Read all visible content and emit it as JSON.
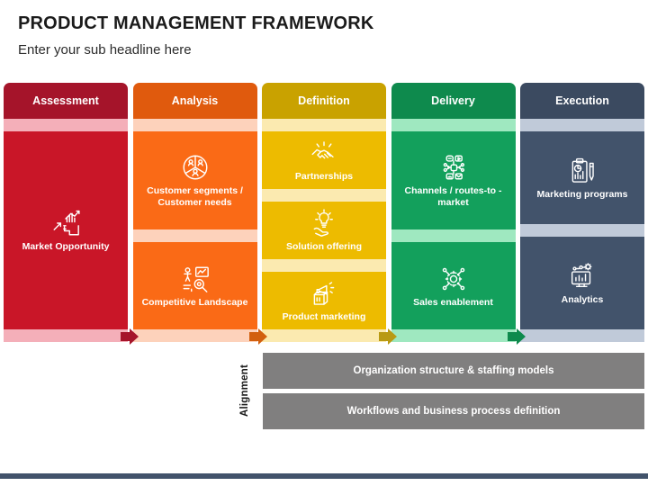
{
  "header": {
    "title": "PRODUCT MANAGEMENT FRAMEWORK",
    "subtitle": "Enter your sub headline here"
  },
  "columns": [
    {
      "name": "assessment",
      "header": "Assessment",
      "header_color": "#a5142a",
      "main_color": "#c91628",
      "tint_color": "#f4afb9",
      "cards": [
        {
          "label": "Market Opportunity",
          "icon": "growth-chart-stairs-icon"
        }
      ]
    },
    {
      "name": "analysis",
      "header": "Analysis",
      "header_color": "#e05a0d",
      "main_color": "#fa6a16",
      "tint_color": "#fdd2bb",
      "cards": [
        {
          "label": "Customer segments / Customer needs",
          "icon": "customer-segments-icon"
        },
        {
          "label": "Competitive Landscape",
          "icon": "competitive-landscape-icon"
        }
      ]
    },
    {
      "name": "definition",
      "header": "Definition",
      "header_color": "#c9a200",
      "main_color": "#edbb00",
      "tint_color": "#fbeab0",
      "cards": [
        {
          "label": "Partnerships",
          "icon": "handshake-icon"
        },
        {
          "label": "Solution offering",
          "icon": "lightbulb-hand-icon"
        },
        {
          "label": "Product marketing",
          "icon": "megaphone-box-icon"
        }
      ]
    },
    {
      "name": "delivery",
      "header": "Delivery",
      "header_color": "#0e8a4d",
      "main_color": "#13a05c",
      "tint_color": "#9fe8c0",
      "cards": [
        {
          "label": "Channels / routes-to -market",
          "icon": "channels-network-icon"
        },
        {
          "label": "Sales enablement",
          "icon": "gear-network-icon"
        }
      ]
    },
    {
      "name": "execution",
      "header": "Execution",
      "header_color": "#3b4a60",
      "main_color": "#42536b",
      "tint_color": "#c0cad9",
      "cards": [
        {
          "label": "Marketing programs",
          "icon": "clipboard-chart-pen-icon"
        },
        {
          "label": "Analytics",
          "icon": "monitor-analytics-icon"
        }
      ]
    }
  ],
  "connectors": [
    {
      "name": "assessment-to-analysis",
      "color": "#a5142a"
    },
    {
      "name": "analysis-to-definition",
      "color": "#d2600f"
    },
    {
      "name": "definition-to-delivery",
      "color": "#b99a13"
    },
    {
      "name": "delivery-to-execution",
      "color": "#0e8a4d"
    }
  ],
  "alignment": {
    "label": "Alignment",
    "bars": [
      "Organization structure & staffing models",
      "Workflows and business process definition"
    ]
  }
}
